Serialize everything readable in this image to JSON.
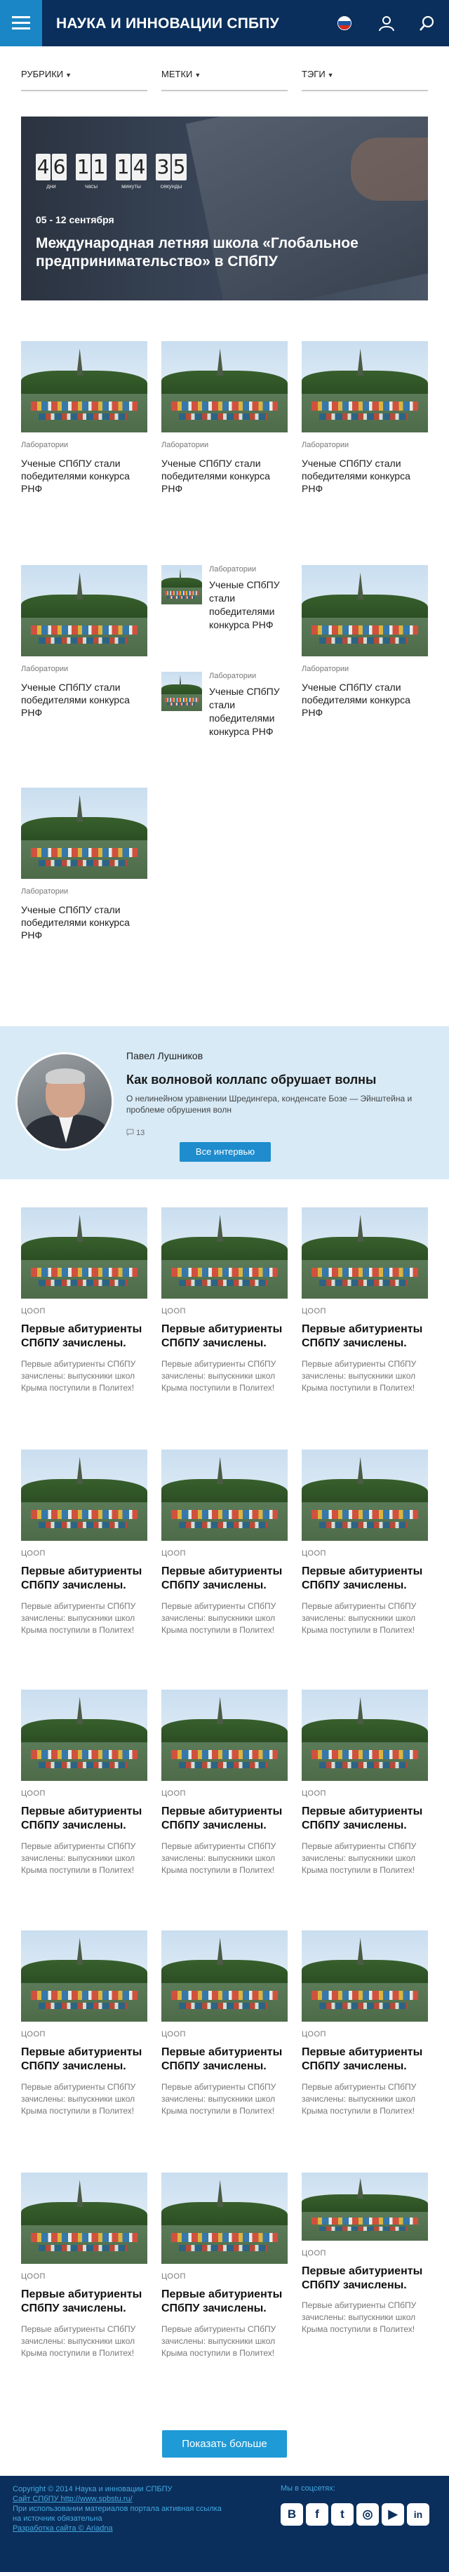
{
  "header": {
    "title": "НАУКА И ИННОВАЦИИ СПБПУ",
    "flag_colors": [
      "#ffffff",
      "#1c57a5",
      "#d52b1e"
    ],
    "icons": [
      "menu-icon",
      "russian-flag-icon",
      "user-icon",
      "search-icon"
    ]
  },
  "filters": [
    {
      "label": "РУБРИКИ"
    },
    {
      "label": "МЕТКИ"
    },
    {
      "label": "ТЭГИ"
    }
  ],
  "hero": {
    "countdown": [
      {
        "digits": [
          "4",
          "6"
        ],
        "label": "дни"
      },
      {
        "digits": [
          "1",
          "1"
        ],
        "label": "часы"
      },
      {
        "digits": [
          "1",
          "4"
        ],
        "label": "минуты"
      },
      {
        "digits": [
          "3",
          "5"
        ],
        "label": "секунды"
      }
    ],
    "date": "05 - 12 сентября",
    "title": "Международная летняя школа «Глобальное предпринимательство» в СПбПУ"
  },
  "lab_cards": {
    "tag": "Лаборатории",
    "title": "Ученые СПбПУ стали победителями конкурса РНФ"
  },
  "interview": {
    "name": "Павел Лушников",
    "title": "Как волновой коллапс обрушает волны",
    "description": "О нелинейном уравнении Шредингера, конденсате Бозе — Эйнштейна и проблеме обрушения волн",
    "comments": "13",
    "button": "Все интервью"
  },
  "news": {
    "tag": "ЦООП",
    "title": "Первые абитуриенты СПбПУ зачислены.",
    "description": "Первые абитуриенты СПбПУ зачислены: выпускники школ Крыма поступили в Политех!"
  },
  "more_button": "Показать больше",
  "footer": {
    "copyright": "Copyright © 2014 Наука и инновации СПБПУ",
    "site": "Сайт СПбПУ http://www.spbstu.ru/",
    "note_line1": "При использовании материалов портала активная ссылка",
    "note_line2": "на источник обязательна",
    "developer": "Разработка сайта © Ariadna",
    "social_label": "Мы в соцсетях:",
    "social": [
      {
        "name": "vk-icon",
        "glyph": "В"
      },
      {
        "name": "facebook-icon",
        "glyph": "f"
      },
      {
        "name": "twitter-icon",
        "glyph": "t"
      },
      {
        "name": "instagram-icon",
        "glyph": "◎"
      },
      {
        "name": "youtube-icon",
        "glyph": "▶"
      },
      {
        "name": "linkedin-icon",
        "glyph": "in"
      }
    ]
  }
}
